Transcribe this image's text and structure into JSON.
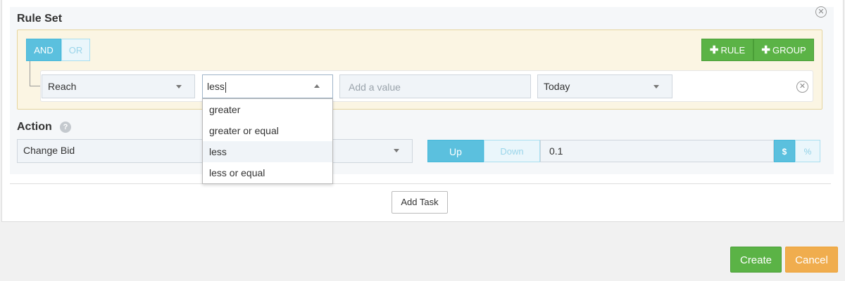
{
  "ruleset": {
    "title": "Rule Set",
    "and_label": "AND",
    "or_label": "OR",
    "add_rule_label": "RULE",
    "add_group_label": "GROUP",
    "rule": {
      "field": "Reach",
      "operator_input": "less",
      "value_placeholder": "Add a value",
      "period": "Today"
    },
    "operator_options": [
      "greater",
      "greater or equal",
      "less",
      "less or equal"
    ],
    "highlighted_option": "less"
  },
  "action": {
    "title": "Action",
    "type": "Change Bid",
    "up_label": "Up",
    "down_label": "Down",
    "amount": "0.1",
    "dollar_label": "$",
    "percent_label": "%"
  },
  "footer": {
    "add_task_label": "Add Task",
    "create_label": "Create",
    "cancel_label": "Cancel"
  },
  "colors": {
    "primary_blue": "#5bc0de",
    "success_green": "#5bb346",
    "warning_orange": "#f0ad4e",
    "ruleset_bg": "#fbf5e3"
  },
  "icons": [
    "close-circle-icon",
    "plus-icon",
    "chevron-down-icon",
    "chevron-up-icon",
    "help-icon"
  ]
}
